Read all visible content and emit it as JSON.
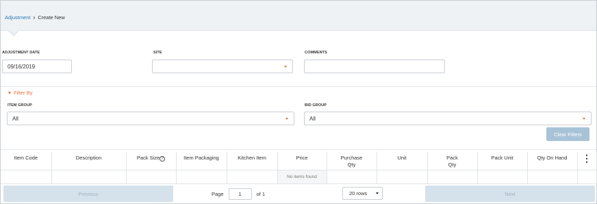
{
  "breadcrumb": {
    "parent": "Adjustment",
    "current": "Create New"
  },
  "form": {
    "adjustment_date_label": "ADJUSTMENT DATE",
    "adjustment_date_value": "09/16/2019",
    "site_label": "SITE",
    "site_value": "",
    "comments_label": "COMMENTS",
    "comments_value": ""
  },
  "filter": {
    "toggle_label": "Filter By",
    "item_group_label": "ITEM GROUP",
    "item_group_value": "All",
    "bid_group_label": "BID GROUP",
    "bid_group_value": "All",
    "clear_label": "Clear Filters"
  },
  "table": {
    "columns": [
      "Item Code",
      "Description",
      "Pack Size",
      "Item Packaging",
      "Kitchen Item",
      "Price",
      "Purchase Qty",
      "Unit",
      "Pack Qty",
      "Pack Unit",
      "Qty On Hand"
    ],
    "purchase_line1": "Purchase",
    "purchase_line2": "Qty",
    "pack_line1": "Pack",
    "pack_line2": "Qty",
    "help_glyph": "?",
    "empty_message": "No items found",
    "menu_glyph": "⋮"
  },
  "pager": {
    "previous_label": "Previous",
    "next_label": "Next",
    "page_label": "Page",
    "page_value": "1",
    "of_label": "of 1",
    "rows_value": "20 rows"
  },
  "colors": {
    "accent": "#e8743b",
    "link": "#2e78b7",
    "button": "#a8c3d8",
    "pager_button": "#d6e2eb"
  }
}
